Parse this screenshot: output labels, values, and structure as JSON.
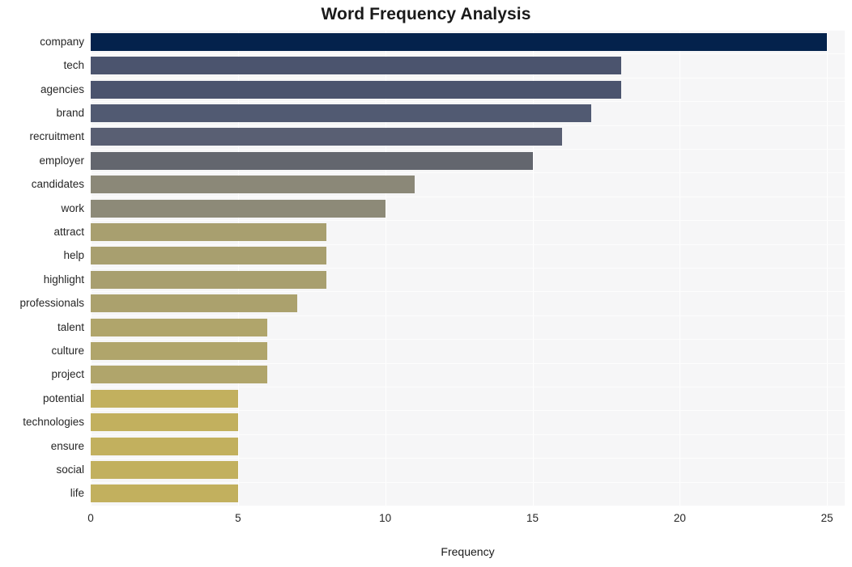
{
  "chart_data": {
    "type": "bar",
    "orientation": "horizontal",
    "title": "Word Frequency Analysis",
    "xlabel": "Frequency",
    "ylabel": "",
    "xlim": [
      0,
      25.6
    ],
    "xticks": [
      0,
      5,
      10,
      15,
      20,
      25
    ],
    "xtick_labels": [
      "0",
      "5",
      "10",
      "15",
      "20",
      "25"
    ],
    "grid": true,
    "grid_axis": "x",
    "legend": false,
    "plot_background": "#f6f6f7",
    "figure_background": "#ffffff",
    "categories": [
      "company",
      "tech",
      "agencies",
      "brand",
      "recruitment",
      "employer",
      "candidates",
      "work",
      "attract",
      "help",
      "highlight",
      "professionals",
      "talent",
      "culture",
      "project",
      "potential",
      "technologies",
      "ensure",
      "social",
      "life"
    ],
    "values": [
      25,
      18,
      18,
      17,
      16,
      15,
      11,
      10,
      8,
      8,
      8,
      7,
      6,
      6,
      6,
      5,
      5,
      5,
      5,
      5
    ],
    "bar_colors": [
      "#04224c",
      "#4b546e",
      "#4b546e",
      "#515a72",
      "#595f73",
      "#63666e",
      "#8b8878",
      "#8d8a78",
      "#a89f6f",
      "#a89f6f",
      "#a89f6f",
      "#ab a16d",
      "#b0a56b",
      "#b0a56b",
      "#b0a56b",
      "#c2b05e",
      "#c2b05e",
      "#c2b05e",
      "#c2b05e",
      "#c2b05e"
    ]
  },
  "chart": {
    "title": "Word Frequency Analysis",
    "x_axis_title": "Frequency"
  }
}
